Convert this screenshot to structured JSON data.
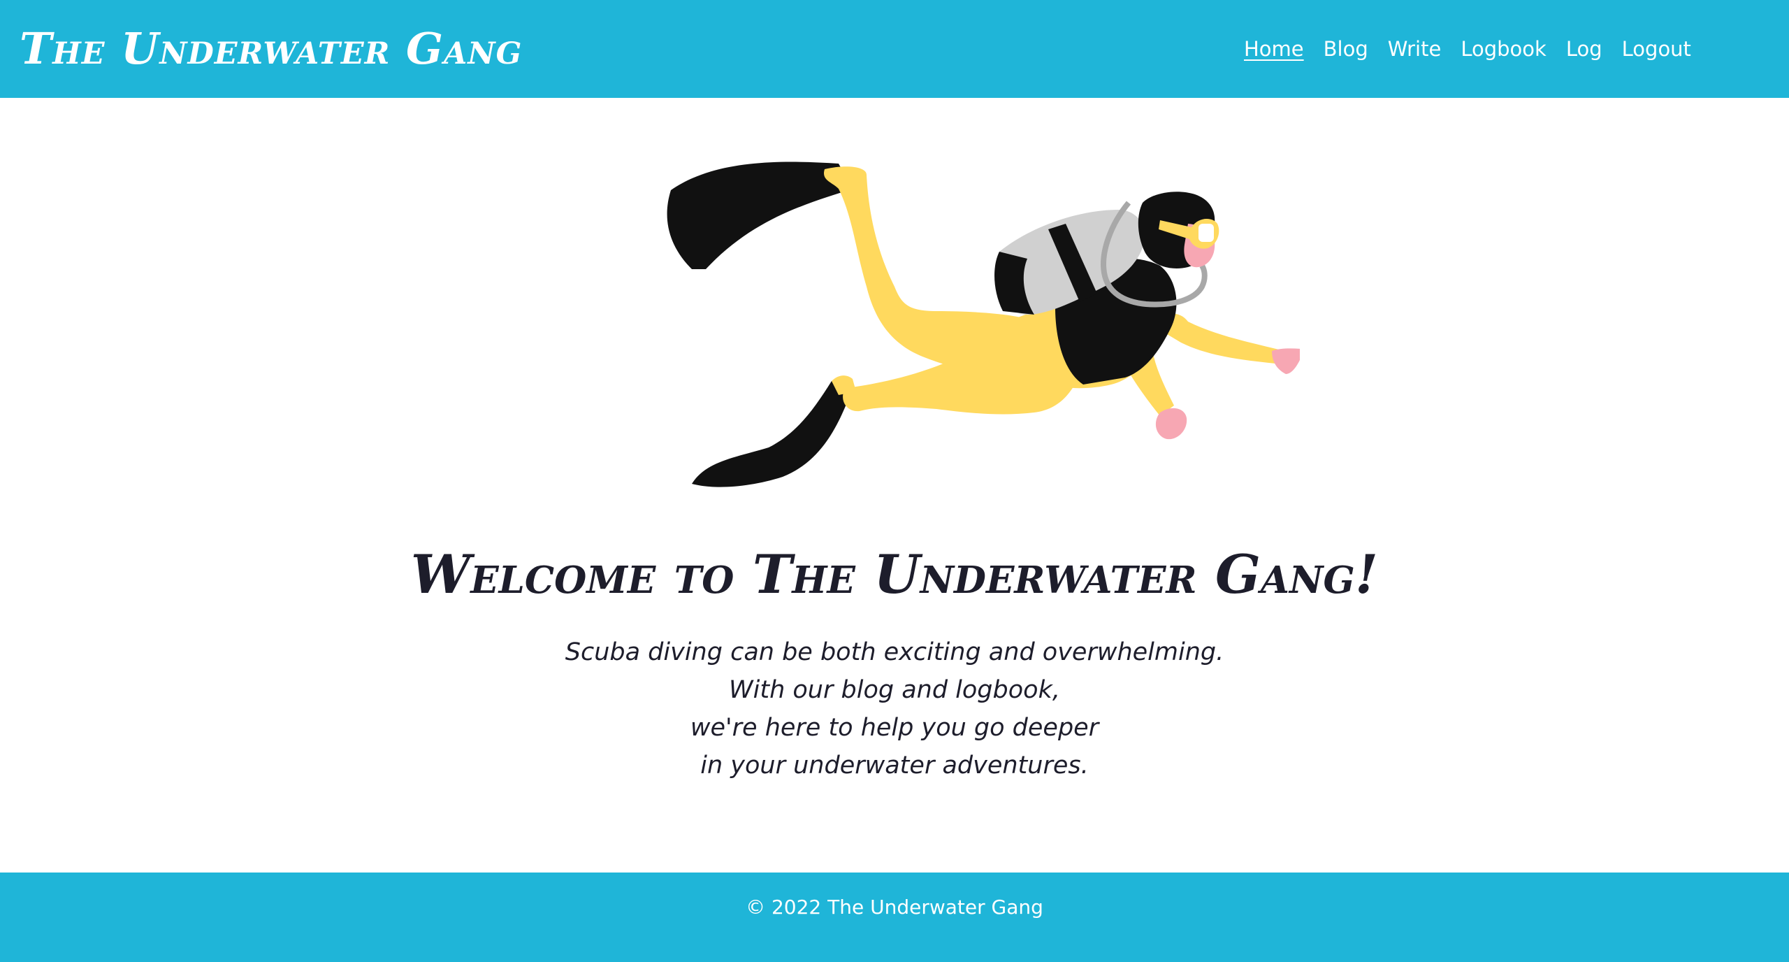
{
  "header": {
    "brand": "The Underwater Gang",
    "nav": [
      {
        "label": "Home",
        "active": true
      },
      {
        "label": "Blog",
        "active": false
      },
      {
        "label": "Write",
        "active": false
      },
      {
        "label": "Logbook",
        "active": false
      },
      {
        "label": "Log",
        "active": false
      },
      {
        "label": "Logout",
        "active": false
      }
    ]
  },
  "main": {
    "illustration": "scuba-diver-illustration",
    "heading": "Welcome to The Underwater Gang!",
    "tagline_lines": [
      "Scuba diving can be both exciting and overwhelming.",
      "With our blog and logbook,",
      "we're here to help you go deeper",
      "in your underwater adventures."
    ]
  },
  "footer": {
    "copyright": "© 2022 The Underwater Gang"
  },
  "colors": {
    "brand_blue": "#1fb5d8",
    "suit_yellow": "#ffd95e",
    "tank_grey": "#cfcfcf",
    "skin_pink": "#f7a7b3",
    "text_dark": "#1d1d2b"
  }
}
